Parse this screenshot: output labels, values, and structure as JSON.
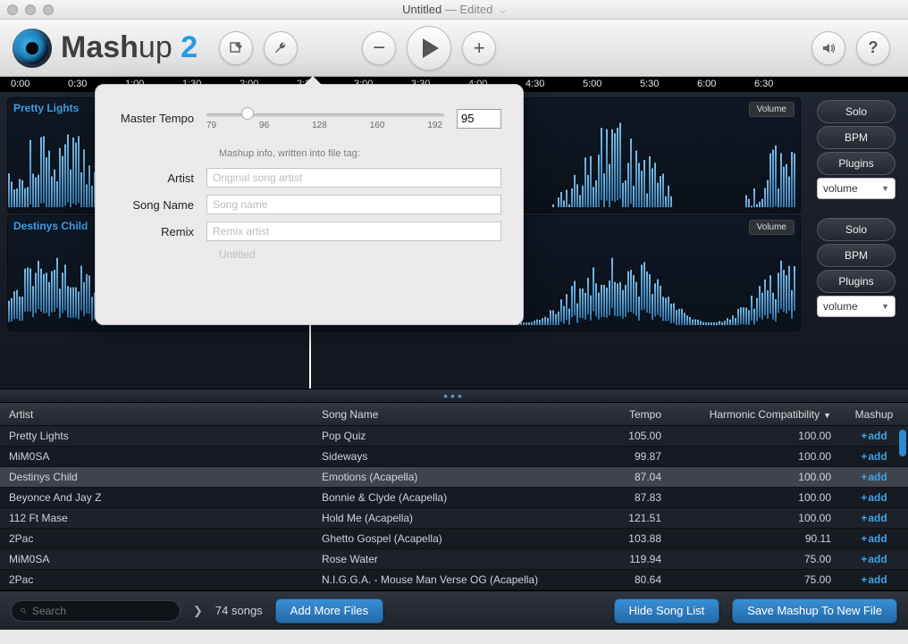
{
  "window": {
    "title": "Untitled",
    "status": "Edited"
  },
  "brand": {
    "part1": "Mash",
    "part2": "up",
    "num": "2"
  },
  "toolbar": {
    "edit": "edit",
    "settings": "settings",
    "zoom_out": "−",
    "play": "play",
    "zoom_in": "+",
    "speaker": "speaker",
    "help": "?"
  },
  "ruler": [
    "0:00",
    "0:30",
    "1:00",
    "1:30",
    "2:00",
    "2:30",
    "3:00",
    "3:30",
    "4:00",
    "4:30",
    "5:00",
    "5:30",
    "6:00",
    "6:30"
  ],
  "tracks": [
    {
      "label": "Pretty Lights",
      "volume_tag": "Volume"
    },
    {
      "label": "Destinys Child",
      "volume_tag": "Volume"
    }
  ],
  "side_buttons": {
    "solo": "Solo",
    "bpm": "BPM",
    "plugins": "Plugins",
    "volume": "volume"
  },
  "popover": {
    "master_tempo_label": "Master Tempo",
    "tempo_value": "95",
    "ticks": [
      "79",
      "96",
      "128",
      "160",
      "192"
    ],
    "info_note": "Mashup info, written into file tag:",
    "artist_label": "Artist",
    "artist_ph": "Original song artist",
    "song_label": "Song Name",
    "song_ph": "Song name",
    "remix_label": "Remix",
    "remix_ph": "Remix artist",
    "untitled": "Untitled"
  },
  "table": {
    "headers": {
      "artist": "Artist",
      "song": "Song Name",
      "tempo": "Tempo",
      "harm": "Harmonic Compatibility",
      "mash": "Mashup"
    },
    "add": "add",
    "rows": [
      {
        "artist": "Pretty Lights",
        "song": "Pop Quiz",
        "tempo": "105.00",
        "harm": "100.00"
      },
      {
        "artist": "MiM0SA",
        "song": "Sideways",
        "tempo": "99.87",
        "harm": "100.00"
      },
      {
        "artist": "Destinys Child",
        "song": "Emotions (Acapella)",
        "tempo": "87.04",
        "harm": "100.00",
        "selected": true
      },
      {
        "artist": "Beyonce And Jay Z",
        "song": "Bonnie & Clyde (Acapella)",
        "tempo": "87.83",
        "harm": "100.00"
      },
      {
        "artist": "112 Ft Mase",
        "song": "Hold Me (Acapella)",
        "tempo": "121.51",
        "harm": "100.00"
      },
      {
        "artist": "2Pac",
        "song": "Ghetto Gospel (Acapella)",
        "tempo": "103.88",
        "harm": "90.11"
      },
      {
        "artist": "MiM0SA",
        "song": "Rose Water",
        "tempo": "119.94",
        "harm": "75.00"
      },
      {
        "artist": "2Pac",
        "song": "N.I.G.G.A. - Mouse Man Verse OG (Acapella)",
        "tempo": "80.64",
        "harm": "75.00"
      }
    ]
  },
  "bottom": {
    "search_ph": "Search",
    "count": "74 songs",
    "add_files": "Add More Files",
    "hide": "Hide Song List",
    "save": "Save Mashup To New File"
  }
}
